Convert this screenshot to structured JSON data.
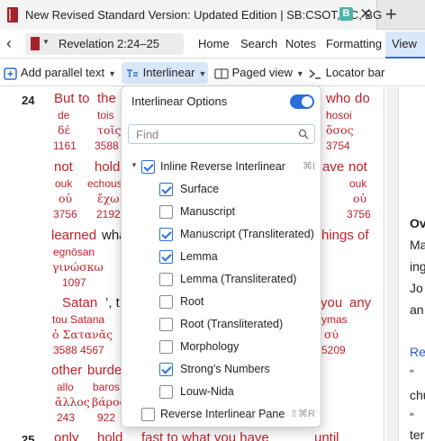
{
  "window": {
    "tab_title": "New Revised Standard Version: Updated Edition | SB:CSOT, TC, BG",
    "tab_badge": "B",
    "close_glyph": "✕",
    "add_glyph": "+"
  },
  "nav": {
    "back_glyph": "‹",
    "reference": "Revelation 2:24–25",
    "menu": [
      "Home",
      "Search",
      "Notes",
      "Formatting",
      "View"
    ],
    "active_menu": "View"
  },
  "toolbar": {
    "add_parallel": "Add parallel text",
    "interlinear": "Interlinear",
    "paged_view": "Paged view",
    "locator_bar": "Locator bar"
  },
  "content": {
    "verse_24": "24",
    "verse_25": "25",
    "words": [
      {
        "en": "But",
        "tr": "de",
        "gk": "δέ",
        "num": "1161"
      },
      {
        "en": "to",
        "tr": "",
        "gk": "",
        "num": ""
      },
      {
        "en": "the",
        "tr": "tois",
        "gk": "τοῖς",
        "num": "3588"
      },
      {
        "en": "who",
        "tr": "hosoi",
        "gk": "ὅσος",
        "num": "3754"
      },
      {
        "en": "do",
        "tr": "",
        "gk": "",
        "num": ""
      },
      {
        "en": "not",
        "tr": "ouk",
        "gk": "οὐ",
        "num": "3756"
      },
      {
        "en": "hold",
        "tr": "echousi",
        "gk": "ἔχω",
        "num": "2192"
      },
      {
        "en": "ave",
        "tr": "",
        "gk": "",
        "num": ""
      },
      {
        "en": "not",
        "tr": "ouk",
        "gk": "οὐ",
        "num": "3756"
      },
      {
        "en": "learned",
        "tr": "egnōsan",
        "gk": "γινώσκω",
        "num": "1097"
      },
      {
        "en": "wha",
        "tr": "",
        "gk": "",
        "num": ""
      },
      {
        "en": "hings of",
        "tr": "",
        "gk": "",
        "num": ""
      },
      {
        "en": "Satan",
        "tr": "tou Satana",
        "gk": "ὁ Σατανᾶς",
        "num": "3588 4567"
      },
      {
        "en": "’, t",
        "tr": "",
        "gk": "",
        "num": ""
      },
      {
        "en": "you",
        "tr": "ymas",
        "gk": "σύ",
        "num": "5209"
      },
      {
        "en": "any",
        "tr": "",
        "gk": "",
        "num": ""
      },
      {
        "en": "other",
        "tr": "allo",
        "gk": "ἄλλος",
        "num": "243"
      },
      {
        "en": "burde",
        "tr": "baros",
        "gk": "βάρος",
        "num": "922"
      },
      {
        "en": "only",
        "tr": "",
        "gk": "",
        "num": ""
      },
      {
        "en": "hold",
        "tr": "",
        "gk": "",
        "num": ""
      },
      {
        "en": "fast to what you have",
        "tr": "",
        "gk": "",
        "num": ""
      },
      {
        "en": "until",
        "tr": "",
        "gk": "",
        "num": ""
      }
    ]
  },
  "right_panel": {
    "lines": [
      "Ov",
      "Ma",
      "ing",
      "Jo",
      "an",
      "Rev",
      "“",
      "chu",
      "“",
      "ter"
    ]
  },
  "dropdown": {
    "title": "Interlinear Options",
    "toggle_on": true,
    "find_placeholder": "Find",
    "inline_reverse": {
      "label": "Inline Reverse Interlinear",
      "checked": true,
      "shortcut": "⌘I"
    },
    "options": [
      {
        "label": "Surface",
        "checked": true
      },
      {
        "label": "Manuscript",
        "checked": false
      },
      {
        "label": "Manuscript (Transliterated)",
        "checked": true
      },
      {
        "label": "Lemma",
        "checked": true
      },
      {
        "label": "Lemma (Transliterated)",
        "checked": false
      },
      {
        "label": "Root",
        "checked": false
      },
      {
        "label": "Root (Transliterated)",
        "checked": false
      },
      {
        "label": "Morphology",
        "checked": false
      },
      {
        "label": "Strong’s Numbers",
        "checked": true
      },
      {
        "label": "Louw-Nida",
        "checked": false
      }
    ],
    "reverse_pane": {
      "label": "Reverse Interlinear Pane",
      "checked": false,
      "shortcut": "⇧⌘R"
    }
  },
  "colors": {
    "accent": "#2a6fd6",
    "words_of_christ": "#c0202a",
    "book_icon": "#a3242a",
    "badge": "#4fb3a8"
  }
}
